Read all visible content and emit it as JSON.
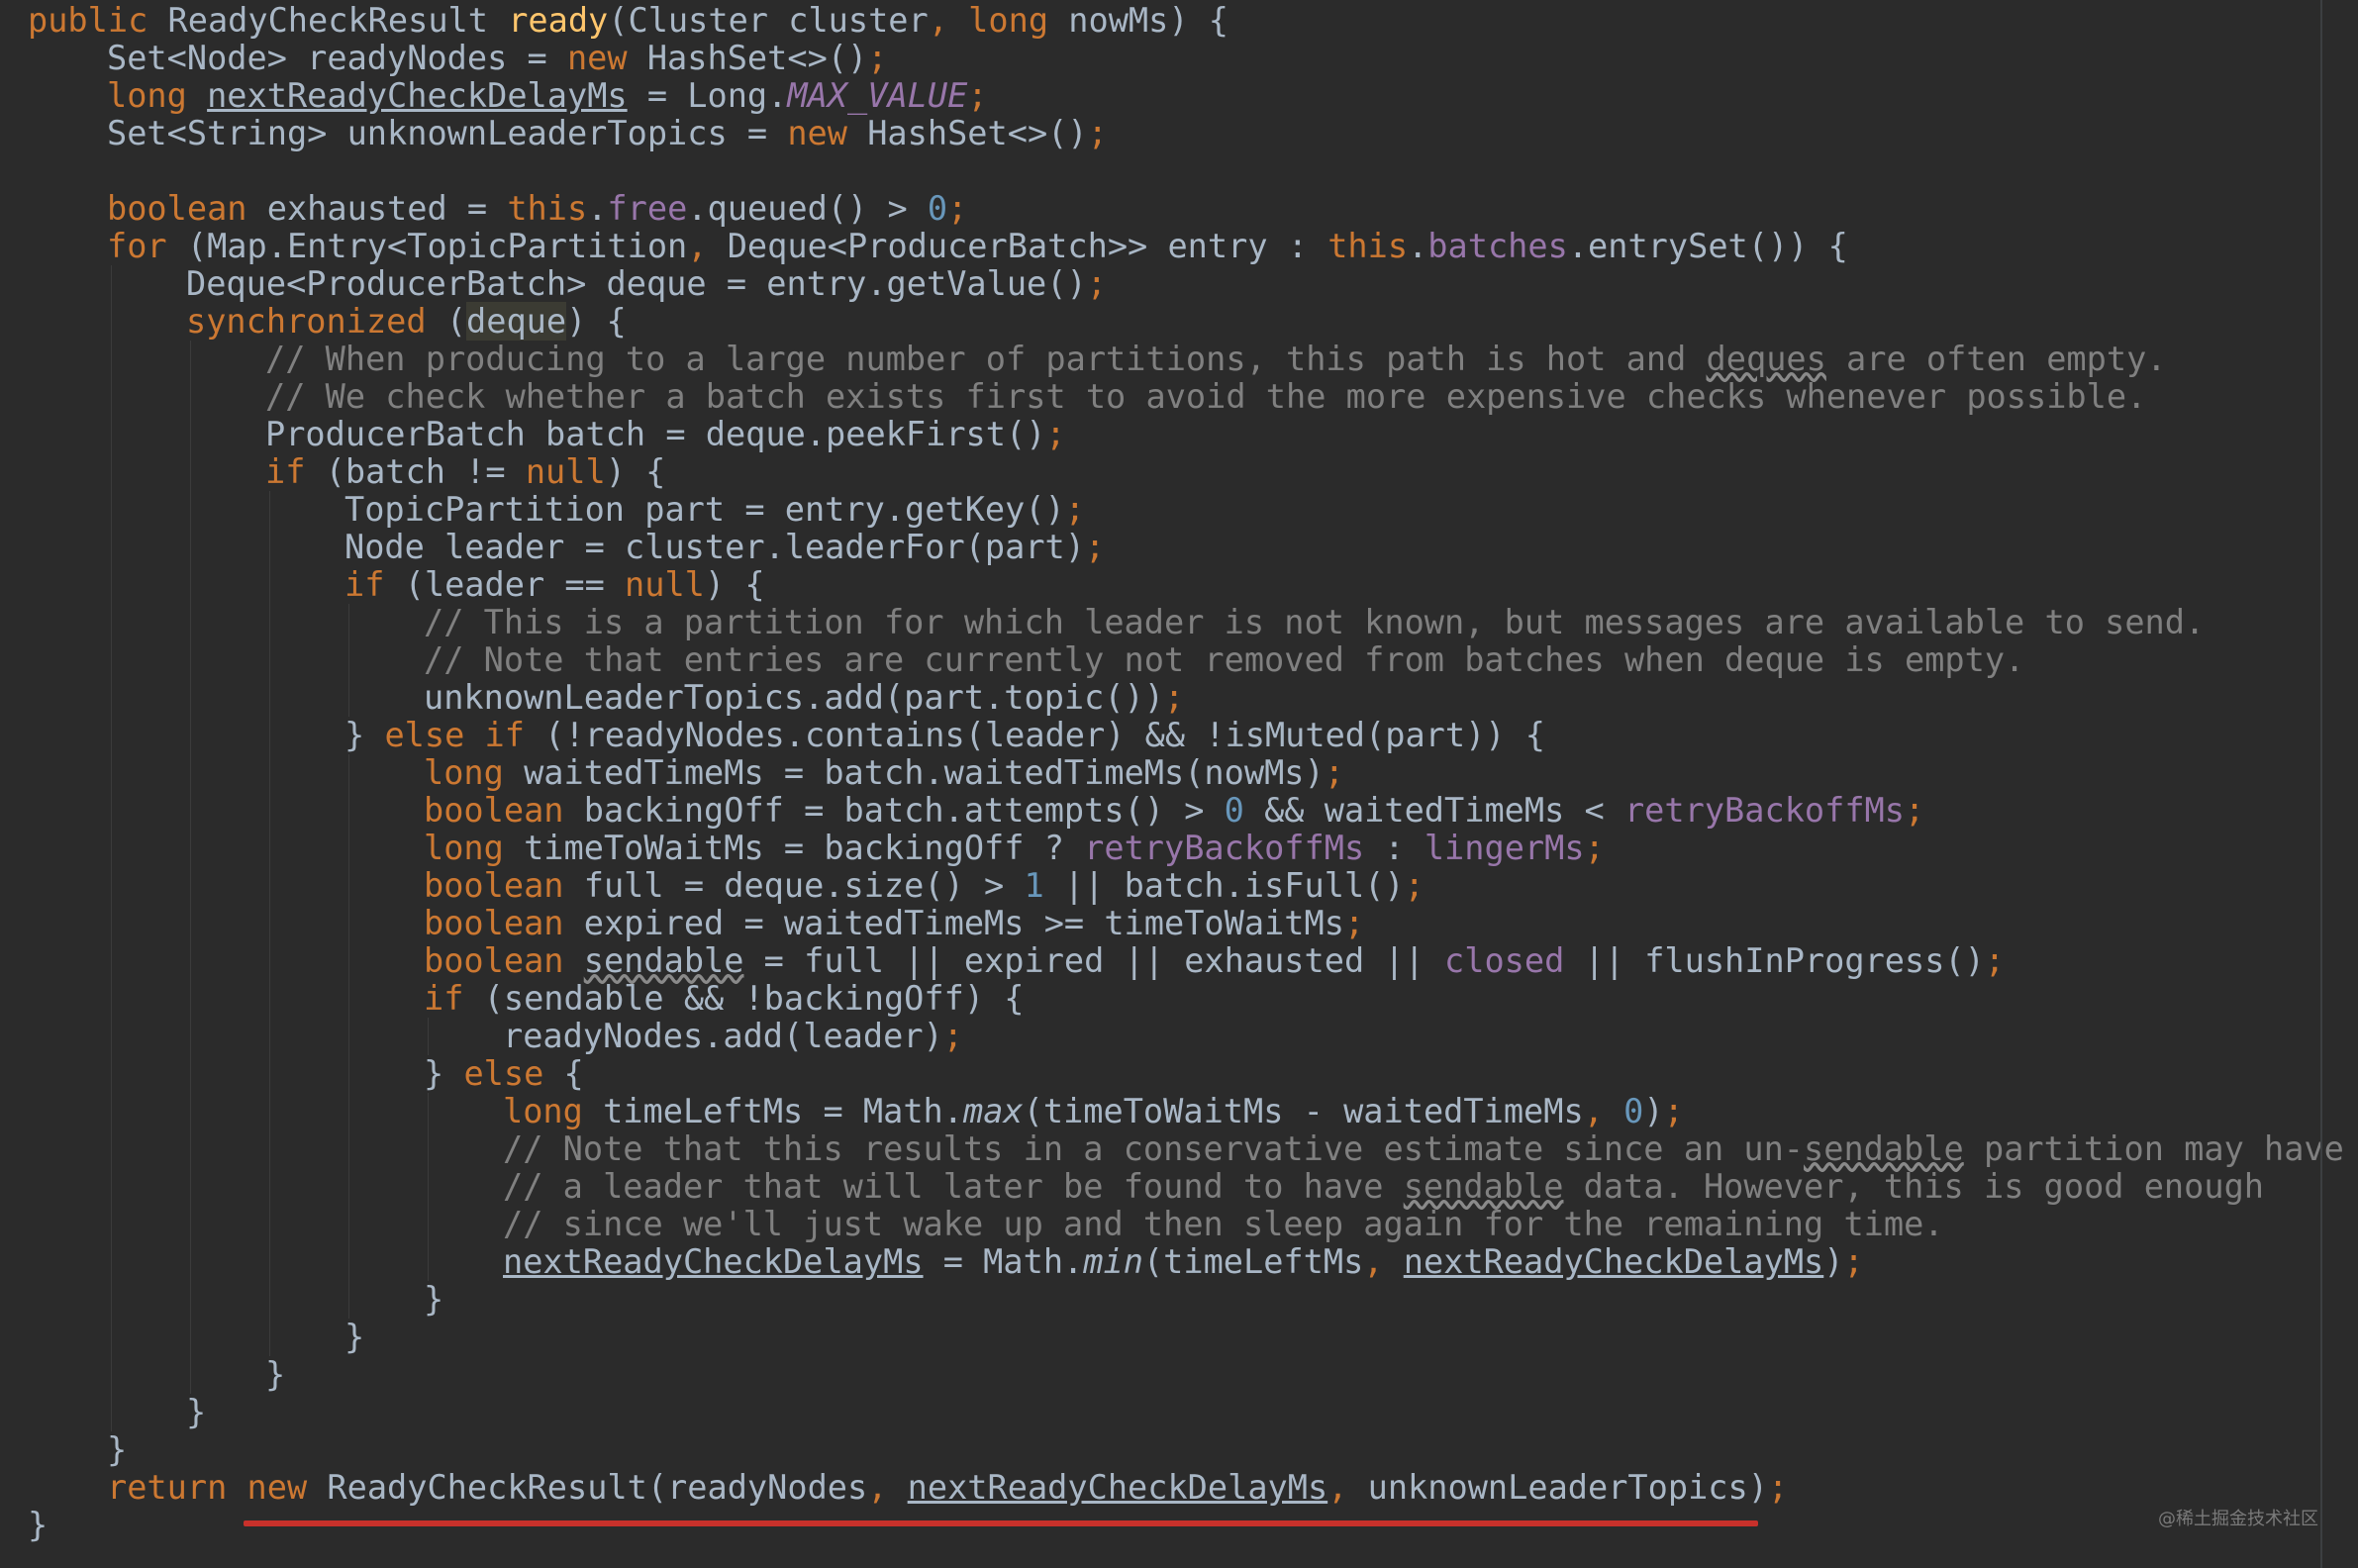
{
  "editor": {
    "theme": "Darcula",
    "colors": {
      "background": "#2b2b2b",
      "default_text": "#a9b7c6",
      "keyword": "#cc7832",
      "method_declaration": "#ffc66d",
      "number": "#6897bb",
      "field": "#9876aa",
      "comment": "#808080",
      "annotation_underline": "#c8312b"
    },
    "lines": [
      {
        "indent": 0,
        "tokens": [
          {
            "t": "public ",
            "c": "kw"
          },
          {
            "t": "ReadyCheckResult "
          },
          {
            "t": "ready",
            "c": "fn"
          },
          {
            "t": "(Cluster cluster"
          },
          {
            "t": ", ",
            "c": "kw"
          },
          {
            "t": "long ",
            "c": "kw"
          },
          {
            "t": "nowMs) {"
          }
        ]
      },
      {
        "indent": 1,
        "tokens": [
          {
            "t": "Set<Node> readyNodes = "
          },
          {
            "t": "new ",
            "c": "kw"
          },
          {
            "t": "HashSet<>()"
          },
          {
            "t": ";",
            "c": "kw"
          }
        ]
      },
      {
        "indent": 1,
        "tokens": [
          {
            "t": "long ",
            "c": "kw"
          },
          {
            "t": "nextReadyCheckDelayMs",
            "c": "under"
          },
          {
            "t": " = Long."
          },
          {
            "t": "MAX_VALUE",
            "c": "field ital"
          },
          {
            "t": ";",
            "c": "kw"
          }
        ]
      },
      {
        "indent": 1,
        "tokens": [
          {
            "t": "Set<String> unknownLeaderTopics = "
          },
          {
            "t": "new ",
            "c": "kw"
          },
          {
            "t": "HashSet<>()"
          },
          {
            "t": ";",
            "c": "kw"
          }
        ]
      },
      {
        "indent": 0,
        "tokens": []
      },
      {
        "indent": 1,
        "tokens": [
          {
            "t": "boolean ",
            "c": "kw"
          },
          {
            "t": "exhausted = "
          },
          {
            "t": "this",
            "c": "kw"
          },
          {
            "t": "."
          },
          {
            "t": "free",
            "c": "field"
          },
          {
            "t": ".queued() > "
          },
          {
            "t": "0",
            "c": "num"
          },
          {
            "t": ";",
            "c": "kw"
          }
        ]
      },
      {
        "indent": 1,
        "tokens": [
          {
            "t": "for ",
            "c": "kw"
          },
          {
            "t": "(Map.Entry<TopicPartition"
          },
          {
            "t": ", ",
            "c": "kw"
          },
          {
            "t": "Deque<ProducerBatch>> entry : "
          },
          {
            "t": "this",
            "c": "kw"
          },
          {
            "t": "."
          },
          {
            "t": "batches",
            "c": "field"
          },
          {
            "t": ".entrySet()) {"
          }
        ]
      },
      {
        "indent": 2,
        "tokens": [
          {
            "t": "Deque<ProducerBatch> deque = entry.getValue()"
          },
          {
            "t": ";",
            "c": "kw"
          }
        ]
      },
      {
        "indent": 2,
        "tokens": [
          {
            "t": "synchronized ",
            "c": "kw"
          },
          {
            "t": "("
          },
          {
            "t": "deque",
            "c": "hl"
          },
          {
            "t": ") {"
          }
        ]
      },
      {
        "indent": 3,
        "tokens": [
          {
            "t": "// When producing to a large number of partitions, this path is hot and ",
            "c": "cmt"
          },
          {
            "t": "deques",
            "c": "cmt squig"
          },
          {
            "t": " are often empty.",
            "c": "cmt"
          }
        ]
      },
      {
        "indent": 3,
        "tokens": [
          {
            "t": "// We check whether a batch exists first to avoid the more expensive checks whenever possible.",
            "c": "cmt"
          }
        ]
      },
      {
        "indent": 3,
        "tokens": [
          {
            "t": "ProducerBatch batch = deque.peekFirst()"
          },
          {
            "t": ";",
            "c": "kw"
          }
        ]
      },
      {
        "indent": 3,
        "tokens": [
          {
            "t": "if ",
            "c": "kw"
          },
          {
            "t": "(batch != "
          },
          {
            "t": "null",
            "c": "kw"
          },
          {
            "t": ") {"
          }
        ]
      },
      {
        "indent": 4,
        "tokens": [
          {
            "t": "TopicPartition part = entry.getKey()"
          },
          {
            "t": ";",
            "c": "kw"
          }
        ]
      },
      {
        "indent": 4,
        "tokens": [
          {
            "t": "Node leader = cluster.leaderFor(part)"
          },
          {
            "t": ";",
            "c": "kw"
          }
        ]
      },
      {
        "indent": 4,
        "tokens": [
          {
            "t": "if ",
            "c": "kw"
          },
          {
            "t": "(leader == "
          },
          {
            "t": "null",
            "c": "kw"
          },
          {
            "t": ") {"
          }
        ]
      },
      {
        "indent": 5,
        "tokens": [
          {
            "t": "// This is a partition for which leader is not known, but messages are available to send.",
            "c": "cmt"
          }
        ]
      },
      {
        "indent": 5,
        "tokens": [
          {
            "t": "// Note that entries are currently not removed from batches when deque is empty.",
            "c": "cmt"
          }
        ]
      },
      {
        "indent": 5,
        "tokens": [
          {
            "t": "unknownLeaderTopics.add(part.topic())"
          },
          {
            "t": ";",
            "c": "kw"
          }
        ]
      },
      {
        "indent": 4,
        "tokens": [
          {
            "t": "} "
          },
          {
            "t": "else if ",
            "c": "kw"
          },
          {
            "t": "(!readyNodes.contains(leader) && !isMuted(part)) {"
          }
        ]
      },
      {
        "indent": 5,
        "tokens": [
          {
            "t": "long ",
            "c": "kw"
          },
          {
            "t": "waitedTimeMs = batch.waitedTimeMs(nowMs)"
          },
          {
            "t": ";",
            "c": "kw"
          }
        ]
      },
      {
        "indent": 5,
        "tokens": [
          {
            "t": "boolean ",
            "c": "kw"
          },
          {
            "t": "backingOff = batch.attempts() > "
          },
          {
            "t": "0",
            "c": "num"
          },
          {
            "t": " && waitedTimeMs < "
          },
          {
            "t": "retryBackoffMs",
            "c": "field"
          },
          {
            "t": ";",
            "c": "kw"
          }
        ]
      },
      {
        "indent": 5,
        "tokens": [
          {
            "t": "long ",
            "c": "kw"
          },
          {
            "t": "timeToWaitMs = backingOff ? "
          },
          {
            "t": "retryBackoffMs",
            "c": "field"
          },
          {
            "t": " : "
          },
          {
            "t": "lingerMs",
            "c": "field"
          },
          {
            "t": ";",
            "c": "kw"
          }
        ]
      },
      {
        "indent": 5,
        "tokens": [
          {
            "t": "boolean ",
            "c": "kw"
          },
          {
            "t": "full = deque.size() > "
          },
          {
            "t": "1",
            "c": "num"
          },
          {
            "t": " || batch.isFull()"
          },
          {
            "t": ";",
            "c": "kw"
          }
        ]
      },
      {
        "indent": 5,
        "tokens": [
          {
            "t": "boolean ",
            "c": "kw"
          },
          {
            "t": "expired = waitedTimeMs >= timeToWaitMs"
          },
          {
            "t": ";",
            "c": "kw"
          }
        ]
      },
      {
        "indent": 5,
        "tokens": [
          {
            "t": "boolean ",
            "c": "kw"
          },
          {
            "t": "sendable",
            "c": "squig"
          },
          {
            "t": " = full || expired || exhausted || "
          },
          {
            "t": "closed",
            "c": "field"
          },
          {
            "t": " || flushInProgress()"
          },
          {
            "t": ";",
            "c": "kw"
          }
        ]
      },
      {
        "indent": 5,
        "tokens": [
          {
            "t": "if ",
            "c": "kw"
          },
          {
            "t": "(sendable && !backingOff) {"
          }
        ]
      },
      {
        "indent": 6,
        "tokens": [
          {
            "t": "readyNodes.add(leader)"
          },
          {
            "t": ";",
            "c": "kw"
          }
        ]
      },
      {
        "indent": 5,
        "tokens": [
          {
            "t": "} "
          },
          {
            "t": "else ",
            "c": "kw"
          },
          {
            "t": "{"
          }
        ]
      },
      {
        "indent": 6,
        "tokens": [
          {
            "t": "long ",
            "c": "kw"
          },
          {
            "t": "timeLeftMs = Math."
          },
          {
            "t": "max",
            "c": "ital"
          },
          {
            "t": "(timeToWaitMs - waitedTimeMs"
          },
          {
            "t": ", ",
            "c": "kw"
          },
          {
            "t": "0",
            "c": "num"
          },
          {
            "t": ")"
          },
          {
            "t": ";",
            "c": "kw"
          }
        ]
      },
      {
        "indent": 6,
        "tokens": [
          {
            "t": "// Note that this results in a conservative estimate since an un-",
            "c": "cmt"
          },
          {
            "t": "sendable",
            "c": "cmt squig"
          },
          {
            "t": " partition may have",
            "c": "cmt"
          }
        ]
      },
      {
        "indent": 6,
        "tokens": [
          {
            "t": "// a leader that will later be found to have ",
            "c": "cmt"
          },
          {
            "t": "sendable",
            "c": "cmt squig"
          },
          {
            "t": " data. However, this is good enough",
            "c": "cmt"
          }
        ]
      },
      {
        "indent": 6,
        "tokens": [
          {
            "t": "// since we'll just wake up and then sleep again for the remaining time.",
            "c": "cmt"
          }
        ]
      },
      {
        "indent": 6,
        "tokens": [
          {
            "t": "nextReadyCheckDelayMs",
            "c": "under"
          },
          {
            "t": " = Math."
          },
          {
            "t": "min",
            "c": "ital"
          },
          {
            "t": "(timeLeftMs"
          },
          {
            "t": ", ",
            "c": "kw"
          },
          {
            "t": "nextReadyCheckDelayMs",
            "c": "under"
          },
          {
            "t": ")"
          },
          {
            "t": ";",
            "c": "kw"
          }
        ]
      },
      {
        "indent": 5,
        "tokens": [
          {
            "t": "}"
          }
        ]
      },
      {
        "indent": 4,
        "tokens": [
          {
            "t": "}"
          }
        ]
      },
      {
        "indent": 3,
        "tokens": [
          {
            "t": "}"
          }
        ]
      },
      {
        "indent": 2,
        "tokens": [
          {
            "t": "}"
          }
        ]
      },
      {
        "indent": 1,
        "tokens": [
          {
            "t": "}"
          }
        ]
      },
      {
        "indent": 1,
        "tokens": [
          {
            "t": "return ",
            "c": "kw"
          },
          {
            "t": "new ",
            "c": "kw"
          },
          {
            "t": "ReadyCheckResult(readyNodes"
          },
          {
            "t": ", ",
            "c": "kw"
          },
          {
            "t": "nextReadyCheckDelayMs",
            "c": "under"
          },
          {
            "t": ", ",
            "c": "kw"
          },
          {
            "t": "unknownLeaderTopics)"
          },
          {
            "t": ";",
            "c": "kw"
          }
        ]
      },
      {
        "indent": 0,
        "tokens": [
          {
            "t": "}"
          }
        ]
      }
    ]
  },
  "watermark": "@稀土掘金技术社区"
}
